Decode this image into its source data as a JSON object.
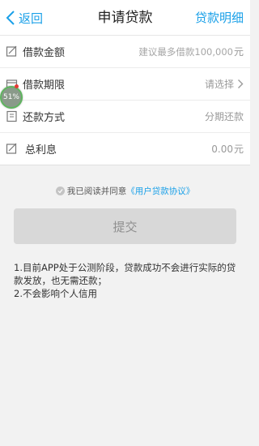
{
  "header": {
    "back_label": "返回",
    "title": "申请贷款",
    "detail_label": "贷款明细"
  },
  "form": {
    "amount": {
      "label": "借款金额",
      "placeholder": "建议最多借款100,000",
      "unit": "元"
    },
    "term": {
      "label": "借款期限",
      "value": "请选择"
    },
    "repay": {
      "label": "还款方式",
      "value": "分期还款"
    },
    "interest": {
      "label": "总利息",
      "value": "0.00",
      "unit": "元"
    }
  },
  "overlay": {
    "badge_text": "51%"
  },
  "agreement": {
    "prefix": "我已阅读并同意",
    "link": "《用户贷款协议》"
  },
  "submit_label": "提交",
  "notes": [
    "1.目前APP处于公测阶段，贷款成功不会进行实际的贷款发放，也无需还款；",
    "2.不会影响个人信用"
  ],
  "colors": {
    "accent": "#1aa0e8",
    "button_bg": "#d8d8d8",
    "page_bg": "#f2f2f2"
  }
}
